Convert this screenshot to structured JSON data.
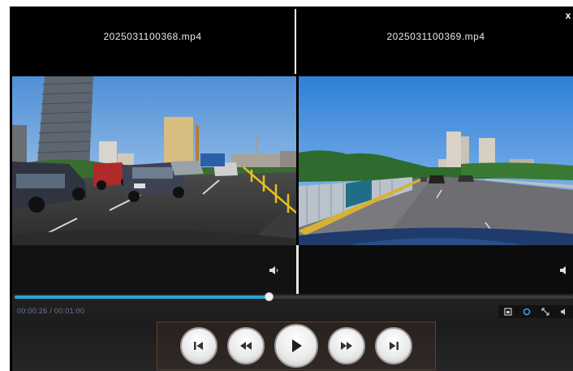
{
  "window": {
    "close_label": "x"
  },
  "panes": [
    {
      "filename": "2025031100368.mp4"
    },
    {
      "filename": "2025031100369.mp4"
    }
  ],
  "player": {
    "time_display": "00:00:26 / 00:01:00",
    "progress_fraction": 0.455
  },
  "icons": {
    "volume_left": "volume-icon",
    "volume_right": "volume-icon",
    "tools": [
      "screenshot-icon",
      "refresh-icon",
      "fullscreen-icon",
      "volume-icon"
    ],
    "controls": [
      "skip-previous-icon",
      "rewind-icon",
      "play-icon",
      "fast-forward-icon",
      "skip-next-icon"
    ]
  },
  "colors": {
    "progress": "#29a6dc",
    "active_tool": "#3fa0e6"
  }
}
